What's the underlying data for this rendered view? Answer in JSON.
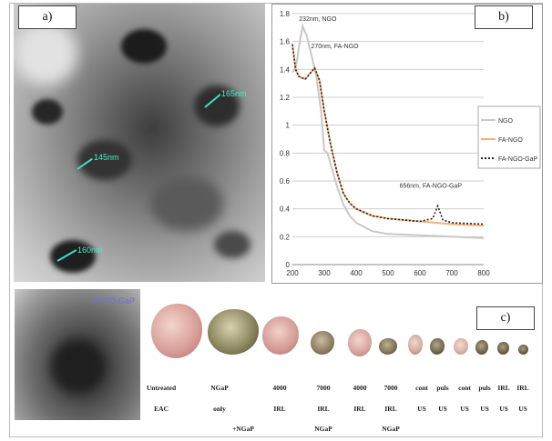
{
  "panels": {
    "a": {
      "label": "a)",
      "scale_bars": [
        "165nm",
        "145nm",
        "160nm"
      ]
    },
    "b": {
      "label": "b)"
    },
    "c": {
      "label": "c)"
    }
  },
  "inset": {
    "label": "FA-GO-GaP"
  },
  "chart_data": {
    "type": "line",
    "title": "",
    "xlabel": "",
    "ylabel": "",
    "xlim": [
      200,
      800
    ],
    "ylim": [
      0,
      1.8
    ],
    "xticks": [
      200,
      300,
      400,
      500,
      600,
      700,
      800
    ],
    "yticks": [
      0,
      0.2,
      0.4,
      0.6,
      0.8,
      1,
      1.2,
      1.4,
      1.6,
      1.8
    ],
    "grid": true,
    "legend_position": "right",
    "annotations": [
      "232nm, NGO",
      "270nm, FA-NGO",
      "656nm, FA-NGO-GaP"
    ],
    "series": [
      {
        "name": "NGO",
        "color": "#c8c8c8",
        "x": [
          200,
          210,
          220,
          232,
          245,
          260,
          275,
          290,
          300,
          310,
          320,
          340,
          360,
          380,
          400,
          450,
          500,
          600,
          700,
          800
        ],
        "y": [
          1.38,
          1.4,
          1.55,
          1.71,
          1.64,
          1.5,
          1.35,
          1.1,
          0.82,
          0.8,
          0.72,
          0.56,
          0.43,
          0.35,
          0.3,
          0.24,
          0.22,
          0.21,
          0.2,
          0.19
        ]
      },
      {
        "name": "FA-NGO",
        "color": "#f2b27a",
        "x": [
          200,
          210,
          220,
          240,
          255,
          270,
          285,
          300,
          320,
          340,
          360,
          380,
          400,
          450,
          500,
          600,
          700,
          800
        ],
        "y": [
          1.58,
          1.4,
          1.35,
          1.33,
          1.37,
          1.41,
          1.32,
          1.1,
          0.86,
          0.66,
          0.51,
          0.44,
          0.4,
          0.35,
          0.33,
          0.31,
          0.29,
          0.28
        ]
      },
      {
        "name": "FA-NGO-GaP",
        "color": "#222222",
        "x": [
          200,
          210,
          220,
          240,
          255,
          270,
          285,
          300,
          320,
          340,
          360,
          380,
          400,
          450,
          500,
          600,
          640,
          656,
          672,
          700,
          800
        ],
        "y": [
          1.58,
          1.4,
          1.35,
          1.33,
          1.37,
          1.41,
          1.32,
          1.1,
          0.86,
          0.66,
          0.51,
          0.44,
          0.4,
          0.35,
          0.33,
          0.31,
          0.33,
          0.42,
          0.32,
          0.3,
          0.29
        ]
      }
    ]
  },
  "tumor_labels": [
    {
      "lines": [
        "Untreated",
        "EAC"
      ]
    },
    {
      "lines": [
        "NGaP",
        "only"
      ]
    },
    {
      "lines": [
        "4000",
        "IRL",
        "+NGaP"
      ]
    },
    {
      "lines": [
        "7000",
        "IRL",
        "NGaP"
      ]
    },
    {
      "lines": [
        "4000",
        "IRL"
      ]
    },
    {
      "lines": [
        "7000",
        "IRL",
        "NGaP"
      ]
    },
    {
      "lines": [
        "cont",
        "US"
      ]
    },
    {
      "lines": [
        "puls",
        "US"
      ]
    },
    {
      "lines": [
        "cont",
        "US"
      ]
    },
    {
      "lines": [
        "puls",
        "US"
      ]
    },
    {
      "lines": [
        "IRL",
        "US"
      ]
    },
    {
      "lines": [
        "IRL",
        "US"
      ]
    }
  ]
}
